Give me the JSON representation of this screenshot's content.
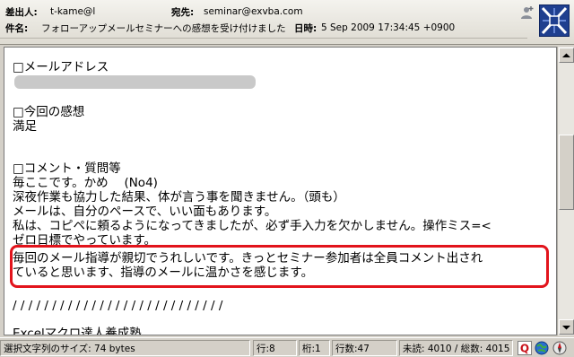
{
  "header": {
    "from_label": "差出人:",
    "from_value": "t-kame@l",
    "to_label": "宛先:",
    "to_value": "seminar@exvba.com",
    "subject_label": "件名:",
    "subject_value": "フォローアップメールセミナーへの感想を受け付けました",
    "date_label": "日時:",
    "date_value": "5 Sep 2009 17:34:45 +0900"
  },
  "body_lines": [
    "□メールアドレス",
    "□今回の感想",
    "満足",
    "□コメント・質問等",
    "毎ここです。かめ　 (No4)",
    "深夜作業も協力した結果、体が言う事を聞きません。（頭も）",
    "メールは、自分のペースで、いい面もあります。",
    "私は、コピペに頼るようになってきましたが、必ず手入力を欠かしません。操作ミス=<",
    "ゼロ日標でやっています。",
    "毎回のメール指導が親切でうれしいです。きっとセミナー参加者は全員コメント出され",
    "ていると思います、指導のメールに温かさを感じます。",
    "/ / / / / / / / / / / / / / / / / / / / / / / / / / /",
    "Excelマクロ達人養成塾"
  ],
  "status": {
    "selection": "選択文字列のサイズ: 74 bytes",
    "row": "行:8",
    "col": "桁:1",
    "lines": "行数:47",
    "unread": "未読: 4010 / 総数: 4015"
  },
  "colors": {
    "highlight": "#e2141c",
    "logo_bg": "#1f3f8f"
  }
}
